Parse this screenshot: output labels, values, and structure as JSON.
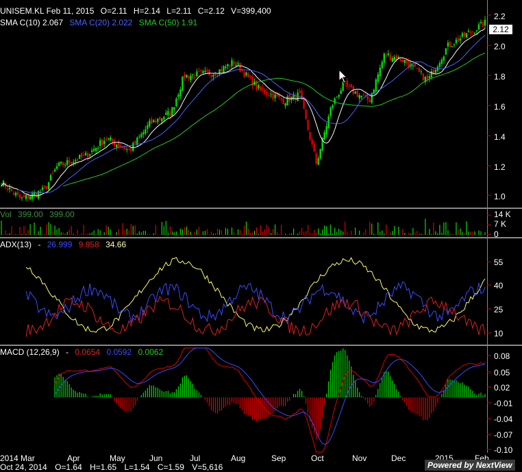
{
  "header": {
    "symbol": "UNISEM.KL Feb 11, 2015",
    "open": "O=2.11",
    "high": "H=2.14",
    "low": "L=2.11",
    "close": "C=2.12",
    "volume": "V=399,400",
    "sma10": "SMA C(10) 2.067",
    "sma20": "SMA C(20) 2.022",
    "sma50": "SMA C(50) 1.91",
    "last_price": "2.12"
  },
  "volume_header": {
    "label": "Vol",
    "v1": "399.00",
    "v2": "399.00"
  },
  "adx_header": {
    "label": "ADX(13)",
    "dash": "-",
    "v1": "26.999",
    "v2": "9.958",
    "v3": "34.66"
  },
  "macd_header": {
    "label": "MACD (12,26,9)",
    "dash": "-",
    "v1": "0.0654",
    "v2": "0.0592",
    "v3": "0.0062"
  },
  "price_ticks": [
    "2.2",
    "2.0",
    "1.8",
    "1.6",
    "1.4",
    "1.2",
    "1.0"
  ],
  "volume_ticks": [
    "14 K",
    "7 K",
    "0"
  ],
  "adx_ticks": [
    "55",
    "40",
    "25",
    "10"
  ],
  "macd_ticks": [
    "0.08",
    "0.05",
    "0.02",
    "-0.01",
    "-0.04",
    "-0.07",
    "-0.10"
  ],
  "months": [
    "2014 Mar",
    "Apr",
    "May",
    "Jun",
    "Jul",
    "Aug",
    "Sep",
    "Oct",
    "Nov",
    "Dec",
    "2015",
    "Feb"
  ],
  "footer": {
    "date": "Oct 24, 2014",
    "open": "O=1.64",
    "high": "H=1.65",
    "low": "L=1.54",
    "close": "C=1.59",
    "volume": "V=5,616",
    "powered": "Powered by NextView"
  },
  "colors": {
    "up": "#00e000",
    "down": "#e00000",
    "sma10": "#ffffff",
    "sma20": "#4a62ff",
    "sma50": "#22cc22",
    "adx": "#ffff66",
    "diplus": "#3b4bff",
    "diminus": "#e02020"
  },
  "chart_data": [
    {
      "type": "candlestick",
      "title": "UNISEM.KL",
      "x_range": [
        "2014-03",
        "2015-02"
      ],
      "ylim": [
        0.95,
        2.25
      ],
      "anchor_closes": [
        {
          "x": "2014-03-01",
          "y": 1.1
        },
        {
          "x": "2014-03-15",
          "y": 0.99
        },
        {
          "x": "2014-04-01",
          "y": 1.05
        },
        {
          "x": "2014-04-10",
          "y": 1.2
        },
        {
          "x": "2014-05-01",
          "y": 1.27
        },
        {
          "x": "2014-05-15",
          "y": 1.38
        },
        {
          "x": "2014-06-01",
          "y": 1.3
        },
        {
          "x": "2014-06-15",
          "y": 1.47
        },
        {
          "x": "2014-07-01",
          "y": 1.55
        },
        {
          "x": "2014-07-10",
          "y": 1.78
        },
        {
          "x": "2014-08-01",
          "y": 1.8
        },
        {
          "x": "2014-08-15",
          "y": 1.87
        },
        {
          "x": "2014-09-01",
          "y": 1.7
        },
        {
          "x": "2014-09-20",
          "y": 1.62
        },
        {
          "x": "2014-10-01",
          "y": 1.66
        },
        {
          "x": "2014-10-13",
          "y": 1.22
        },
        {
          "x": "2014-10-24",
          "y": 1.59
        },
        {
          "x": "2014-11-01",
          "y": 1.72
        },
        {
          "x": "2014-11-20",
          "y": 1.62
        },
        {
          "x": "2014-12-01",
          "y": 1.92
        },
        {
          "x": "2014-12-15",
          "y": 1.88
        },
        {
          "x": "2015-01-01",
          "y": 1.75
        },
        {
          "x": "2015-01-15",
          "y": 1.97
        },
        {
          "x": "2015-02-11",
          "y": 2.12
        }
      ],
      "series": [
        {
          "name": "SMA C(10)",
          "last": 2.067
        },
        {
          "name": "SMA C(20)",
          "last": 2.022
        },
        {
          "name": "SMA C(50)",
          "last": 1.91
        }
      ]
    },
    {
      "type": "bar",
      "title": "Vol",
      "ylim": [
        0,
        14000
      ]
    },
    {
      "type": "line",
      "title": "ADX(13)",
      "ylim": [
        5,
        60
      ],
      "series": [
        {
          "name": "ADX",
          "last": 34.66
        },
        {
          "name": "DI+",
          "last": 26.999
        },
        {
          "name": "DI-",
          "last": 9.958
        }
      ]
    },
    {
      "type": "line",
      "title": "MACD (12,26,9)",
      "ylim": [
        -0.1,
        0.09
      ],
      "series": [
        {
          "name": "MACD",
          "last": 0.0654
        },
        {
          "name": "Signal",
          "last": 0.0592
        },
        {
          "name": "Histogram",
          "last": 0.0062
        }
      ]
    }
  ]
}
